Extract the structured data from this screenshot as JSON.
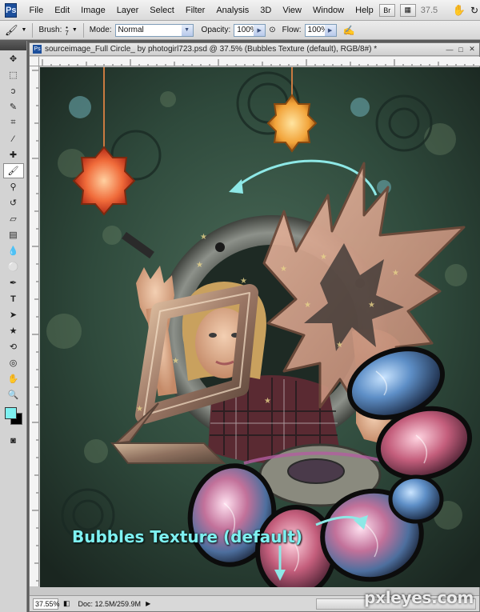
{
  "app": {
    "logo": "Ps"
  },
  "menu": [
    "File",
    "Edit",
    "Image",
    "Layer",
    "Select",
    "Filter",
    "Analysis",
    "3D",
    "View",
    "Window",
    "Help"
  ],
  "menubar_right": {
    "zoom_value": "37.5"
  },
  "options": {
    "brush_label": "Brush:",
    "brush_size": "7",
    "mode_label": "Mode:",
    "mode_value": "Normal",
    "opacity_label": "Opacity:",
    "opacity_value": "100%",
    "flow_label": "Flow:",
    "flow_value": "100%"
  },
  "document": {
    "title": "sourceimage_Full Circle_ by photogirl723.psd @ 37.5% (Bubbles Texture (default), RGB/8#) *",
    "caption": "Bubbles Texture (default)"
  },
  "status": {
    "zoom": "37.55%",
    "doc_info": "Doc: 12.5M/259.9M"
  },
  "watermark": "pxleyes.com",
  "colors": {
    "foreground": "#7ef1f1",
    "background": "#000000",
    "caption": "#7ef1f1"
  }
}
